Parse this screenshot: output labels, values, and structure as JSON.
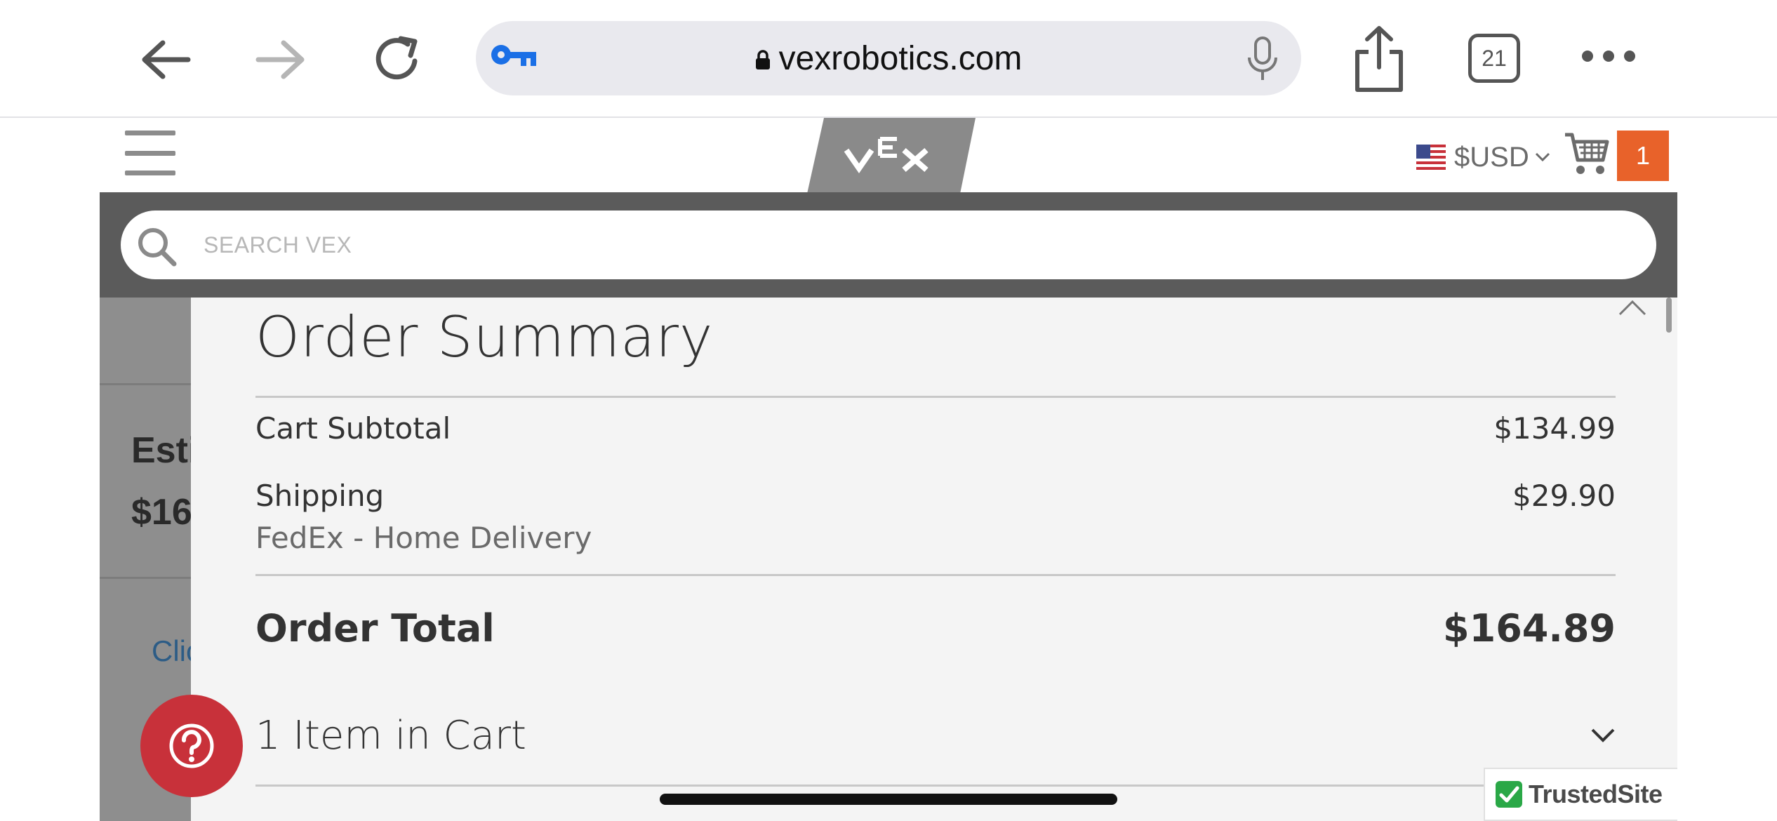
{
  "browser": {
    "url": "vexrobotics.com",
    "tab_count": "21",
    "back_icon": "arrow-left-icon",
    "forward_icon": "arrow-right-icon",
    "reload_icon": "reload-icon",
    "share_icon": "share-icon",
    "more_icon": "ellipsis-icon"
  },
  "site_header": {
    "logo": "VEX",
    "currency": "$USD",
    "cart_count": "1",
    "accent_color": "#e8622a"
  },
  "search": {
    "placeholder": "SEARCH VEX"
  },
  "background_page": {
    "estimate_label_fragment": "Esti",
    "estimate_amount_fragment": "$16",
    "link_fragment": "Clic"
  },
  "order_summary": {
    "title": "Order Summary",
    "rows": [
      {
        "label": "Cart Subtotal",
        "value": "$134.99"
      },
      {
        "label": "Shipping",
        "value": "$29.90",
        "sub": "FedEx - Home Delivery"
      }
    ],
    "total_label": "Order Total",
    "total_value": "$164.89",
    "items_label": "1 Item in Cart"
  },
  "badges": {
    "trusted_site": "TrustedSite",
    "help_color": "#c8313a"
  }
}
